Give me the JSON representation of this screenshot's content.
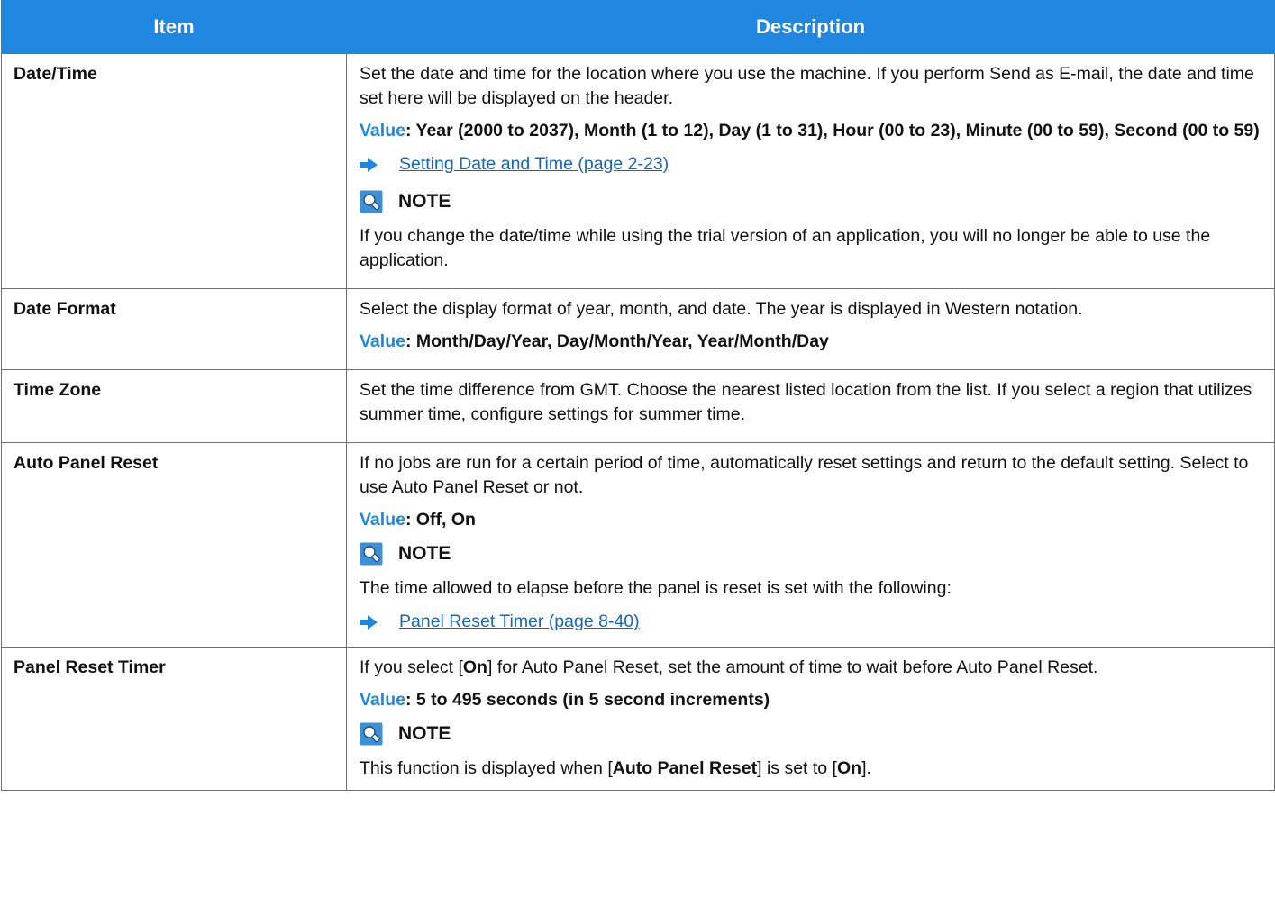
{
  "table": {
    "headers": {
      "item": "Item",
      "description": "Description"
    },
    "rows": [
      {
        "item": "Date/Time",
        "desc": "Set the date and time for the location where you use the machine. If you perform Send as E-mail, the date and time set here will be displayed on the header.",
        "value_label": "Value",
        "value_text": ": Year (2000 to 2037), Month (1 to 12), Day (1 to 31), Hour (00 to 23), Minute (00 to 59), Second (00 to 59)",
        "link": "Setting Date and Time (page 2-23)",
        "note_label": "NOTE",
        "note_text": "If you change the date/time while using the trial version of an application, you will no longer be able to use the application."
      },
      {
        "item": "Date Format",
        "desc": "Select the display format of year, month, and date. The year is displayed in Western notation.",
        "value_label": "Value",
        "value_text": ": Month/Day/Year, Day/Month/Year, Year/Month/Day"
      },
      {
        "item": "Time Zone",
        "desc": "Set the time difference from GMT. Choose the nearest listed location from the list. If you select a region that utilizes summer time, configure settings for summer time."
      },
      {
        "item": "Auto Panel Reset",
        "desc": "If no jobs are run for a certain period of time, automatically reset settings and return to the default setting. Select to use Auto Panel Reset or not.",
        "value_label": "Value",
        "value_text": ": Off, On",
        "note_label": "NOTE",
        "note_text": "The time allowed to elapse before the panel is reset is set with the following:",
        "link": "Panel Reset Timer (page 8-40)"
      },
      {
        "item": "Panel Reset Timer",
        "desc_parts": [
          "If you select [",
          "On",
          "] for Auto Panel Reset, set the amount of time to wait before Auto Panel Reset."
        ],
        "value_label": "Value",
        "value_text": ": 5 to 495 seconds (in 5 second increments)",
        "note_label": "NOTE",
        "note_parts": [
          "This function is displayed when [",
          "Auto Panel Reset",
          "] is set to [",
          "On",
          "]."
        ]
      }
    ]
  },
  "colors": {
    "header_bg": "#1f87e0",
    "accent": "#1f87e0",
    "link": "#1565c0",
    "border": "#6f6f6f"
  },
  "icons": {
    "arrow": "arrow-right-icon",
    "note": "note-lightbulb-icon"
  }
}
